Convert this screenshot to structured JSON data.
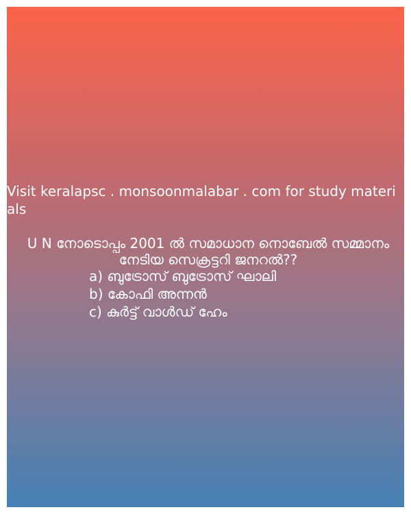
{
  "visit_text": "Visit keralapsc . monsoonmalabar . com for study materials",
  "question": "U N നോടൊപ്പം 2001 ൽ സമാധാന നൊബേൽ സമ്മാനം നേടിയ സെക്രട്ടറി ജനറൽ??",
  "options": [
    "a) ബുട്രോസ് ബുട്രോസ് ഘാലി",
    "b) കോഫി അന്നൻ",
    "c) കുർട്ട് വാൾഡ് ഹേം"
  ],
  "colors": {
    "gradient_top": "#fc634a",
    "gradient_bottom": "#4580b4",
    "text": "#ffffff"
  }
}
